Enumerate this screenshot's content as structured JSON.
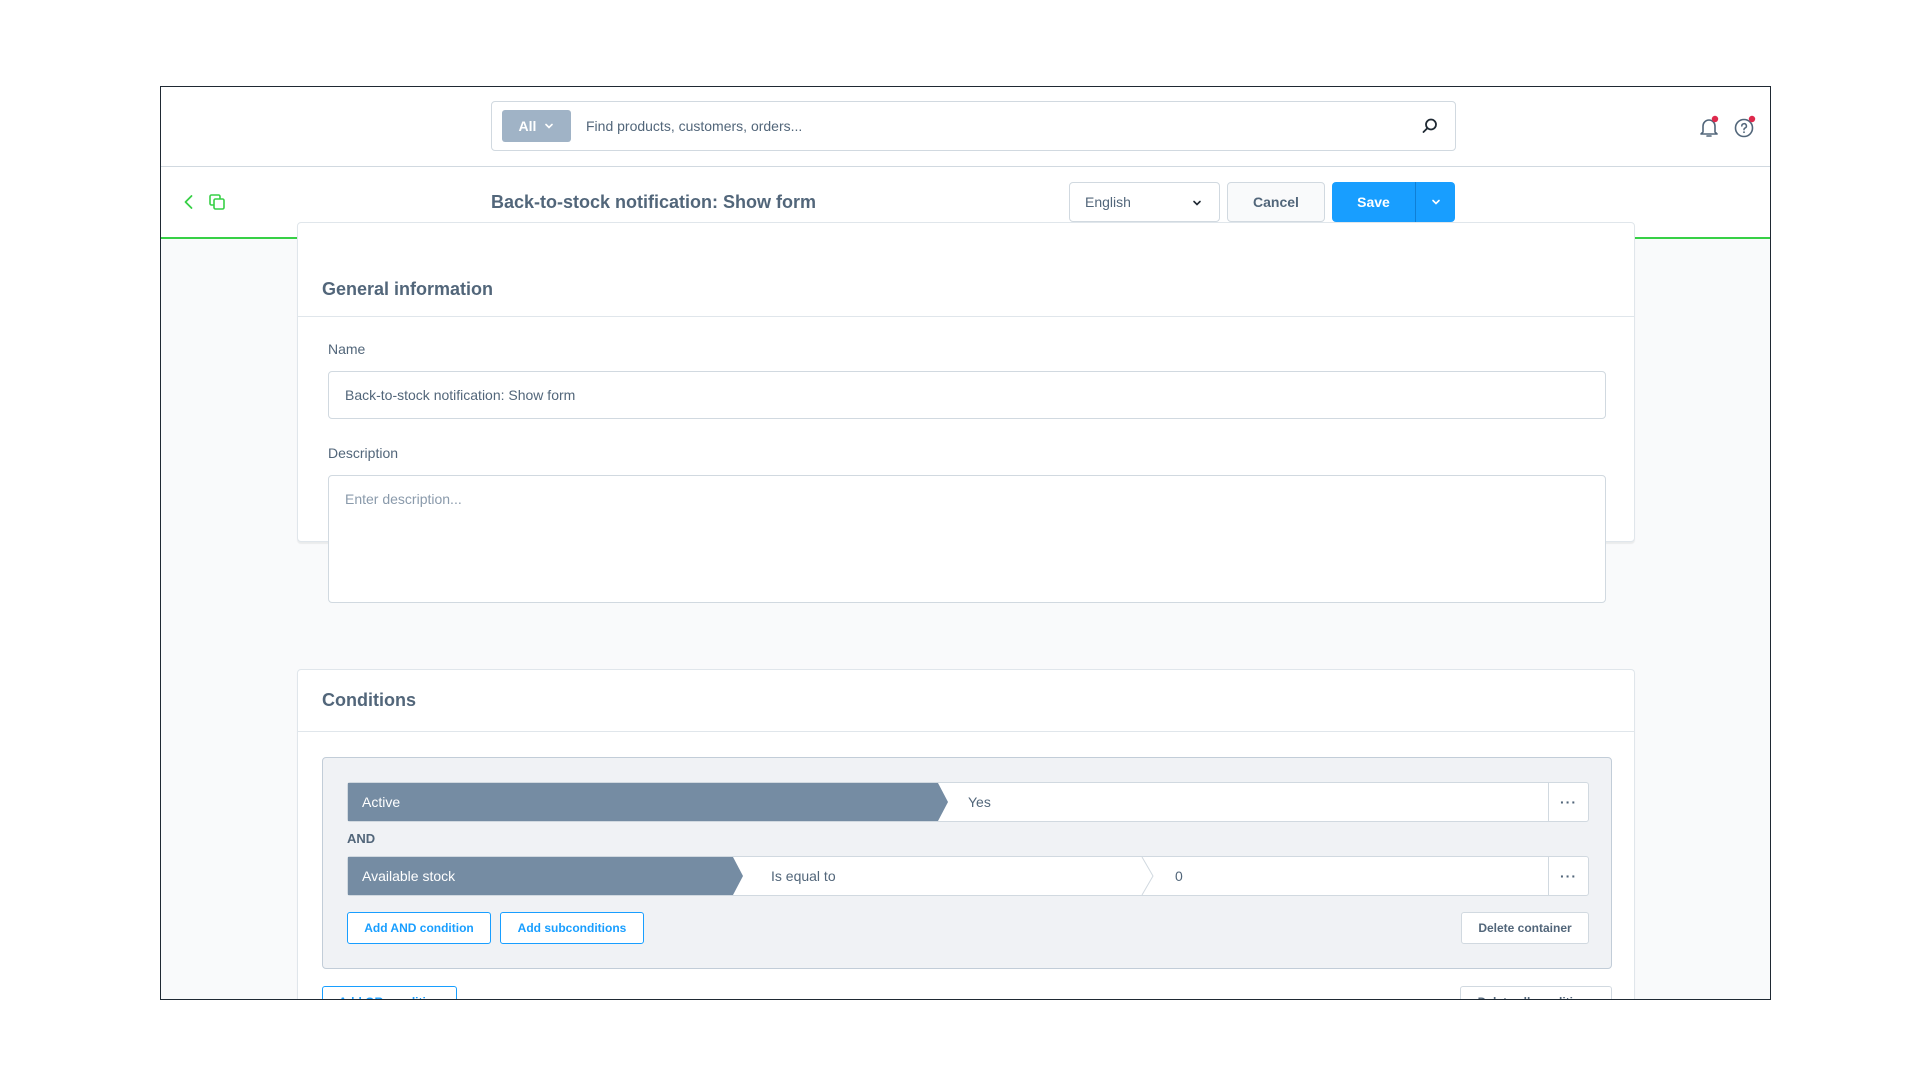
{
  "search": {
    "type_label": "All",
    "placeholder": "Find products, customers, orders..."
  },
  "header": {
    "title": "Back-to-stock notification: Show form",
    "language": "English",
    "cancel_label": "Cancel",
    "save_label": "Save"
  },
  "general": {
    "title": "General information",
    "name_label": "Name",
    "name_value": "Back-to-stock notification: Show form",
    "description_label": "Description",
    "description_placeholder": "Enter description..."
  },
  "conditions": {
    "title": "Conditions",
    "rows": [
      {
        "field": "Active",
        "value": "Yes"
      },
      {
        "field": "Available stock",
        "operator": "Is equal to",
        "value": "0"
      }
    ],
    "connector": "AND",
    "menu_label": "···",
    "add_and_label": "Add AND condition",
    "add_sub_label": "Add subconditions",
    "delete_container_label": "Delete container",
    "add_or_label": "Add OR condition",
    "delete_all_label": "Delete all conditions"
  },
  "colors": {
    "primary": "#189eff",
    "accent_green": "#37d046",
    "condition_field": "#758ca3",
    "notification_dot": "#de294c"
  }
}
